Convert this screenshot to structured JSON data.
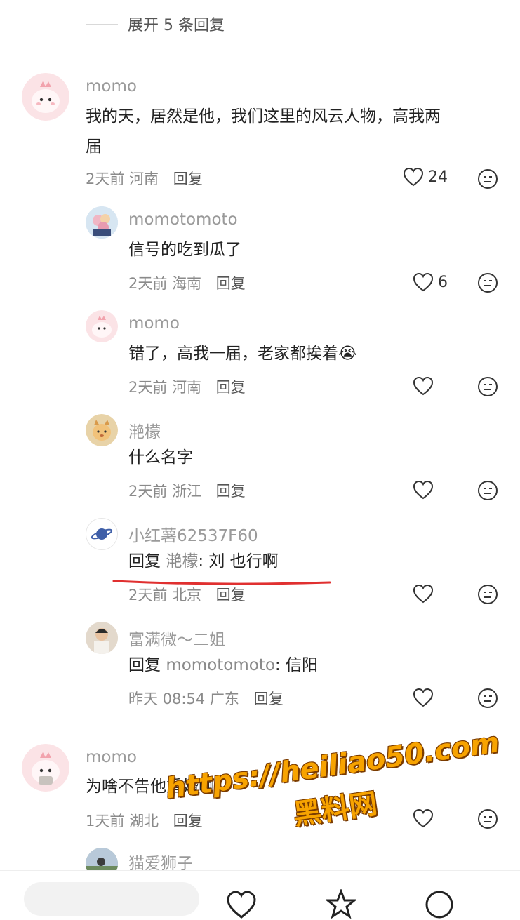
{
  "expand": {
    "label": "展开 5 条回复"
  },
  "comments": [
    {
      "name": "momo",
      "text_line1": "我的天，居然是他，我们这里的风云人物，高我两",
      "text_line2": "届",
      "time": "2天前",
      "location": "河南",
      "reply_label": "回复",
      "likes": "24",
      "replies": [
        {
          "name": "momotomoto",
          "text": "信号的吃到瓜了",
          "time": "2天前",
          "location": "海南",
          "reply_label": "回复",
          "likes": "6"
        },
        {
          "name": "momo",
          "text": "错了，高我一届，老家都挨着",
          "emoji": "😭",
          "time": "2天前",
          "location": "河南",
          "reply_label": "回复"
        },
        {
          "name": "滟檬",
          "text": "什么名字",
          "time": "2天前",
          "location": "浙江",
          "reply_label": "回复"
        },
        {
          "name": "小红薯62537F60",
          "reply_prefix": "回复",
          "mention": "滟檬",
          "text": ": 刘  也行啊",
          "time": "2天前",
          "location": "北京",
          "reply_label": "回复"
        },
        {
          "name": "富满微～二姐",
          "reply_prefix": "回复",
          "mention": "momotomoto",
          "text": ": 信阳",
          "time": "昨天 08:54",
          "location": "广东",
          "reply_label": "回复"
        }
      ]
    },
    {
      "name": "momo",
      "text": "为啥不告他重婚啊",
      "time": "1天前",
      "location": "湖北",
      "reply_label": "回复",
      "next_reply_name": "猫爱狮子"
    }
  ],
  "watermark": {
    "url": "https://heiliao50.com",
    "name": "黑料网"
  },
  "colors": {
    "accent_red": "#e03030",
    "watermark": "#f7a300",
    "muted": "#8a8a8a"
  }
}
